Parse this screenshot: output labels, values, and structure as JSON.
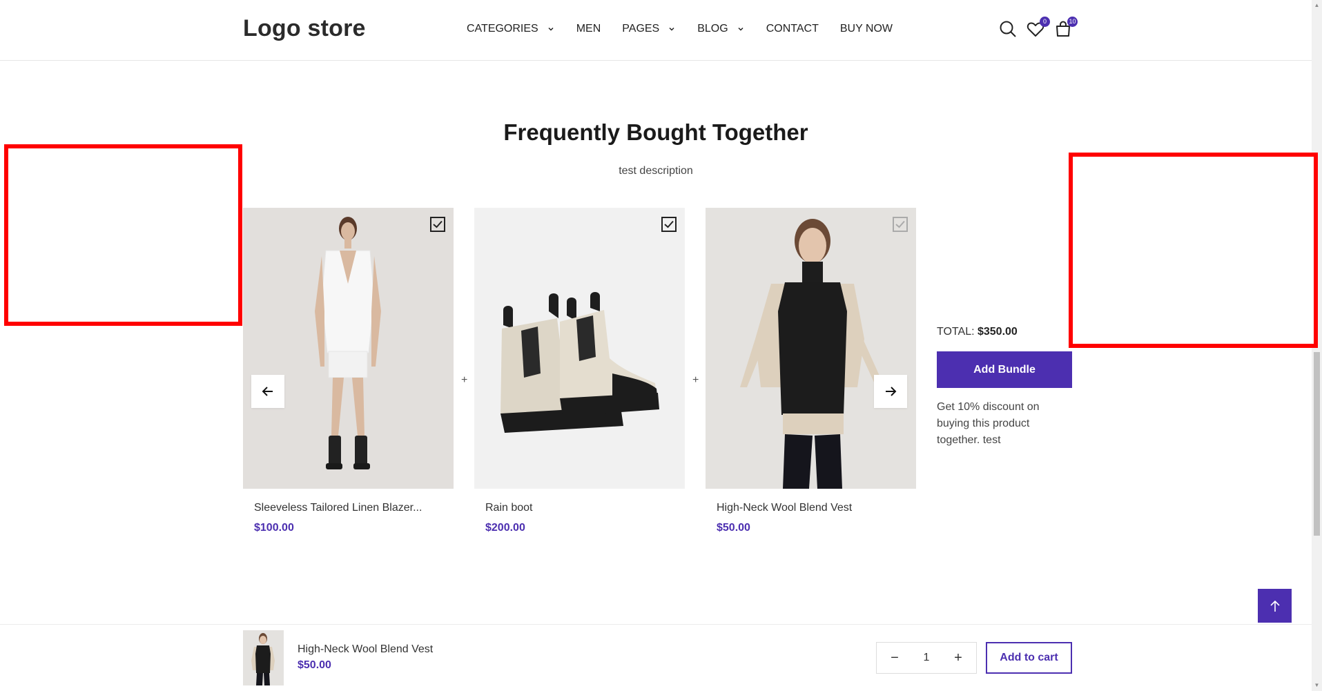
{
  "header": {
    "logo": "Logo store",
    "nav": [
      {
        "label": "CATEGORIES",
        "dropdown": true
      },
      {
        "label": "MEN",
        "dropdown": false
      },
      {
        "label": "PAGES",
        "dropdown": true
      },
      {
        "label": "BLOG",
        "dropdown": true
      },
      {
        "label": "CONTACT",
        "dropdown": false
      },
      {
        "label": "BUY NOW",
        "dropdown": false
      }
    ],
    "wishlist_count": "0",
    "cart_count": "10"
  },
  "section": {
    "title": "Frequently Bought Together",
    "description": "test description"
  },
  "products": [
    {
      "name": "Sleeveless Tailored Linen Blazer...",
      "price": "$100.00",
      "checked": true
    },
    {
      "name": "Rain boot",
      "price": "$200.00",
      "checked": true
    },
    {
      "name": "High-Neck Wool Blend Vest",
      "price": "$50.00",
      "checked": true
    }
  ],
  "plus_sign": "+",
  "bundle": {
    "total_label": "TOTAL:",
    "total_value": "$350.00",
    "button": "Add Bundle",
    "discount_text": "Get 10% discount on buying this product together. test"
  },
  "sticky": {
    "name": "High-Neck Wool Blend Vest",
    "price": "$50.00",
    "qty": "1",
    "minus": "−",
    "plus": "+",
    "add_to_cart": "Add to cart"
  },
  "colors": {
    "accent": "#4c2fb0",
    "annotation_red": "#ff0000"
  }
}
